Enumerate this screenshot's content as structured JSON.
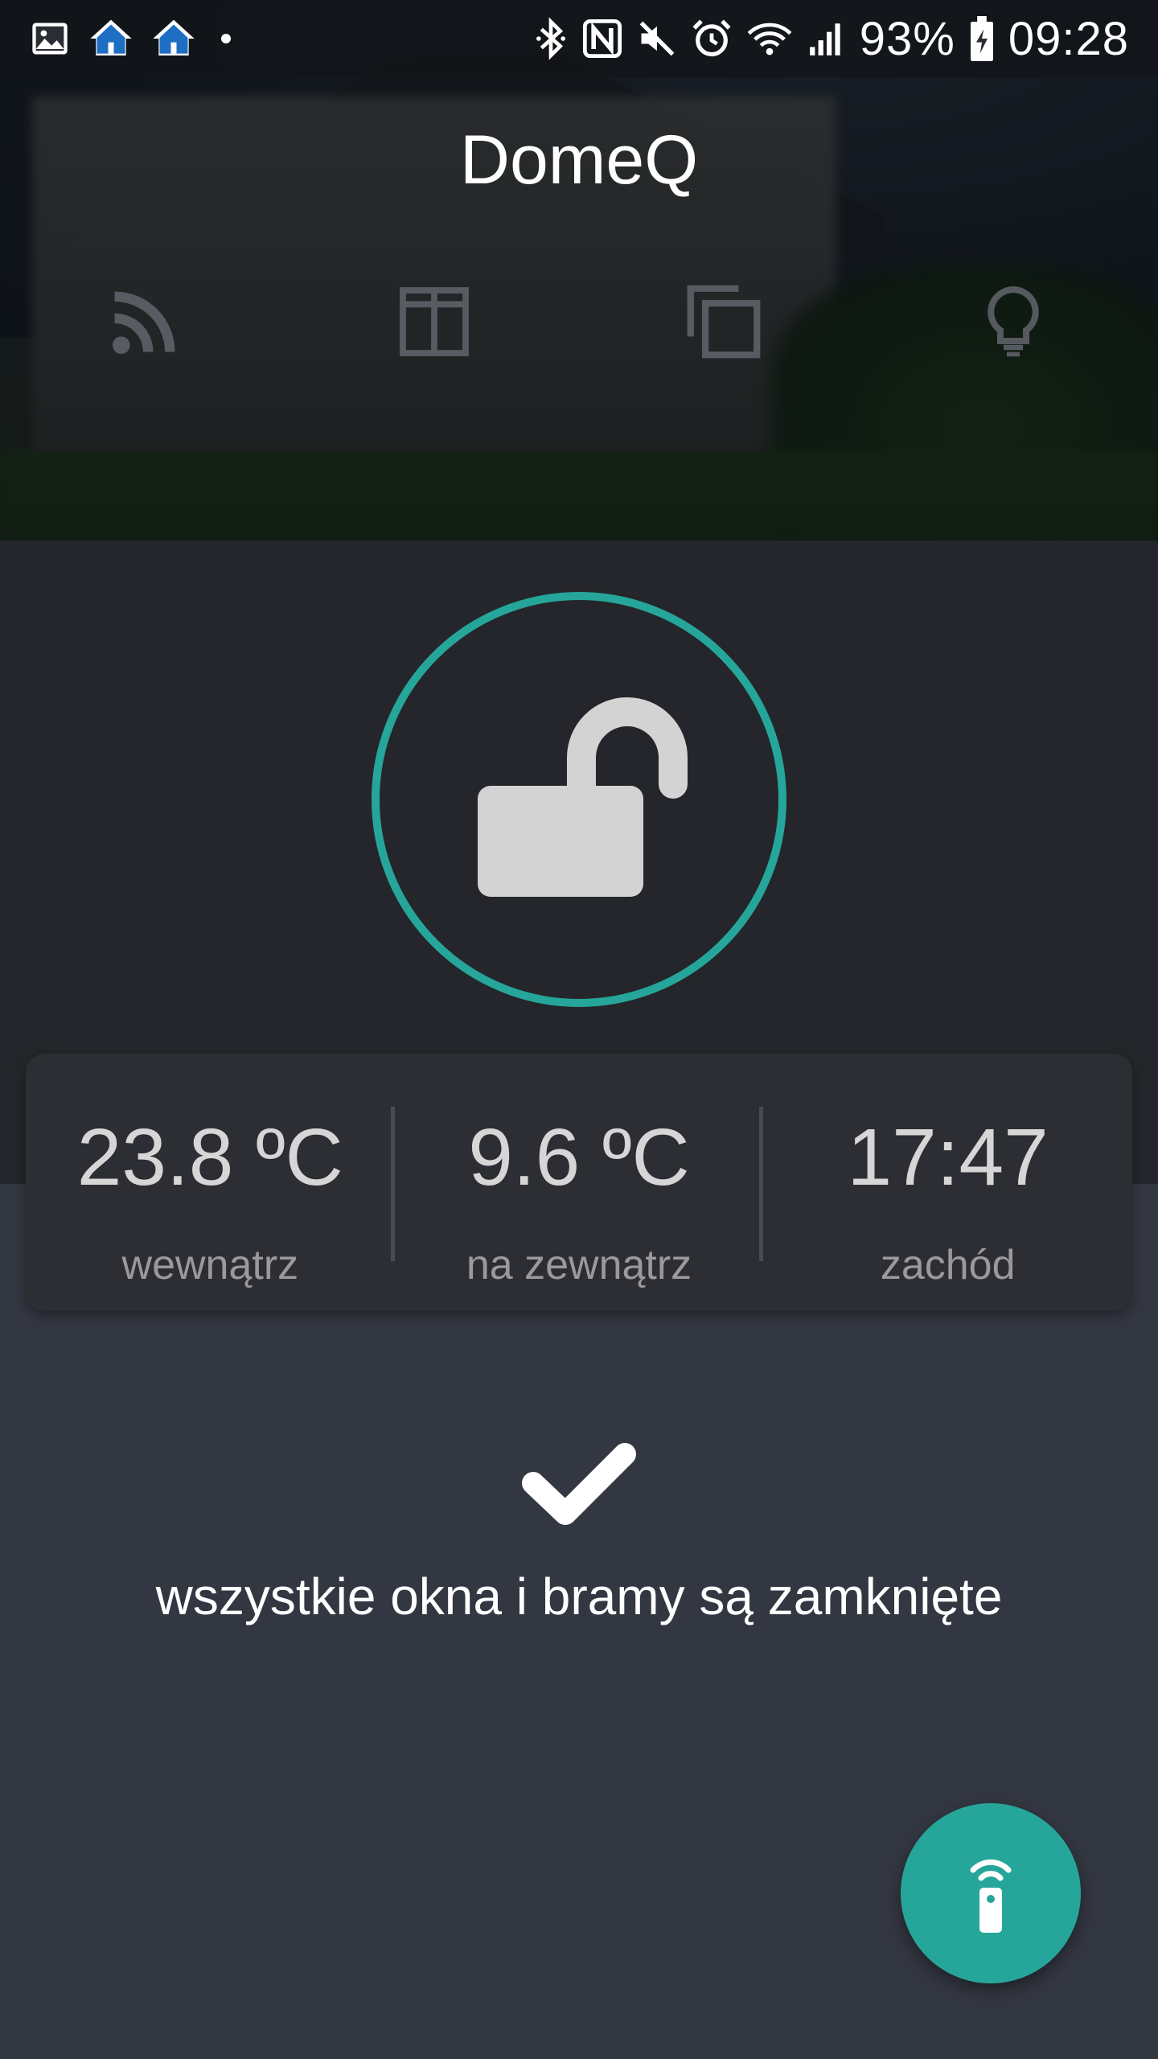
{
  "status_bar": {
    "battery_percent": "93%",
    "time": "09:28",
    "left_icons": [
      "gallery-icon",
      "home-icon",
      "home-icon",
      "dot-icon"
    ],
    "right_icons": [
      "bluetooth-icon",
      "nfc-icon",
      "mute-icon",
      "alarm-icon",
      "wifi-icon",
      "signal-icon",
      "battery-charging-icon"
    ]
  },
  "app": {
    "title": "DomeQ",
    "accent_color": "#26a69a"
  },
  "nav": {
    "items": [
      {
        "icon": "rss-feed-icon"
      },
      {
        "icon": "window-icon"
      },
      {
        "icon": "copy-windows-icon"
      },
      {
        "icon": "lightbulb-icon"
      }
    ]
  },
  "lock": {
    "state_icon": "unlocked-padlock-icon"
  },
  "stats": [
    {
      "value": "23.8 ºC",
      "label": "wewnątrz"
    },
    {
      "value": "9.6 ºC",
      "label": "na zewnątrz"
    },
    {
      "value": "17:47",
      "label": "zachód"
    }
  ],
  "status": {
    "icon": "checkmark-icon",
    "message": "wszystkie okna i bramy są zamknięte"
  },
  "fab": {
    "icon": "remote-control-icon"
  }
}
